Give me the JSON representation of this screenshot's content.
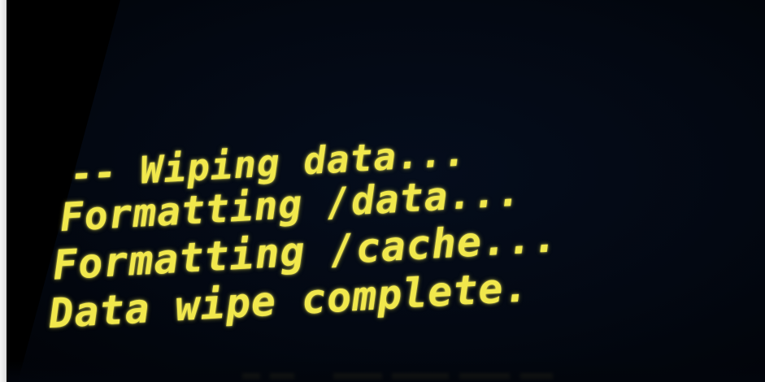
{
  "console": {
    "lines": [
      "-- Wiping data...",
      "Formatting /data...",
      "Formatting /cache...",
      "Data wipe complete."
    ]
  },
  "colors": {
    "text": "#f1e84c",
    "background": "#030812"
  }
}
